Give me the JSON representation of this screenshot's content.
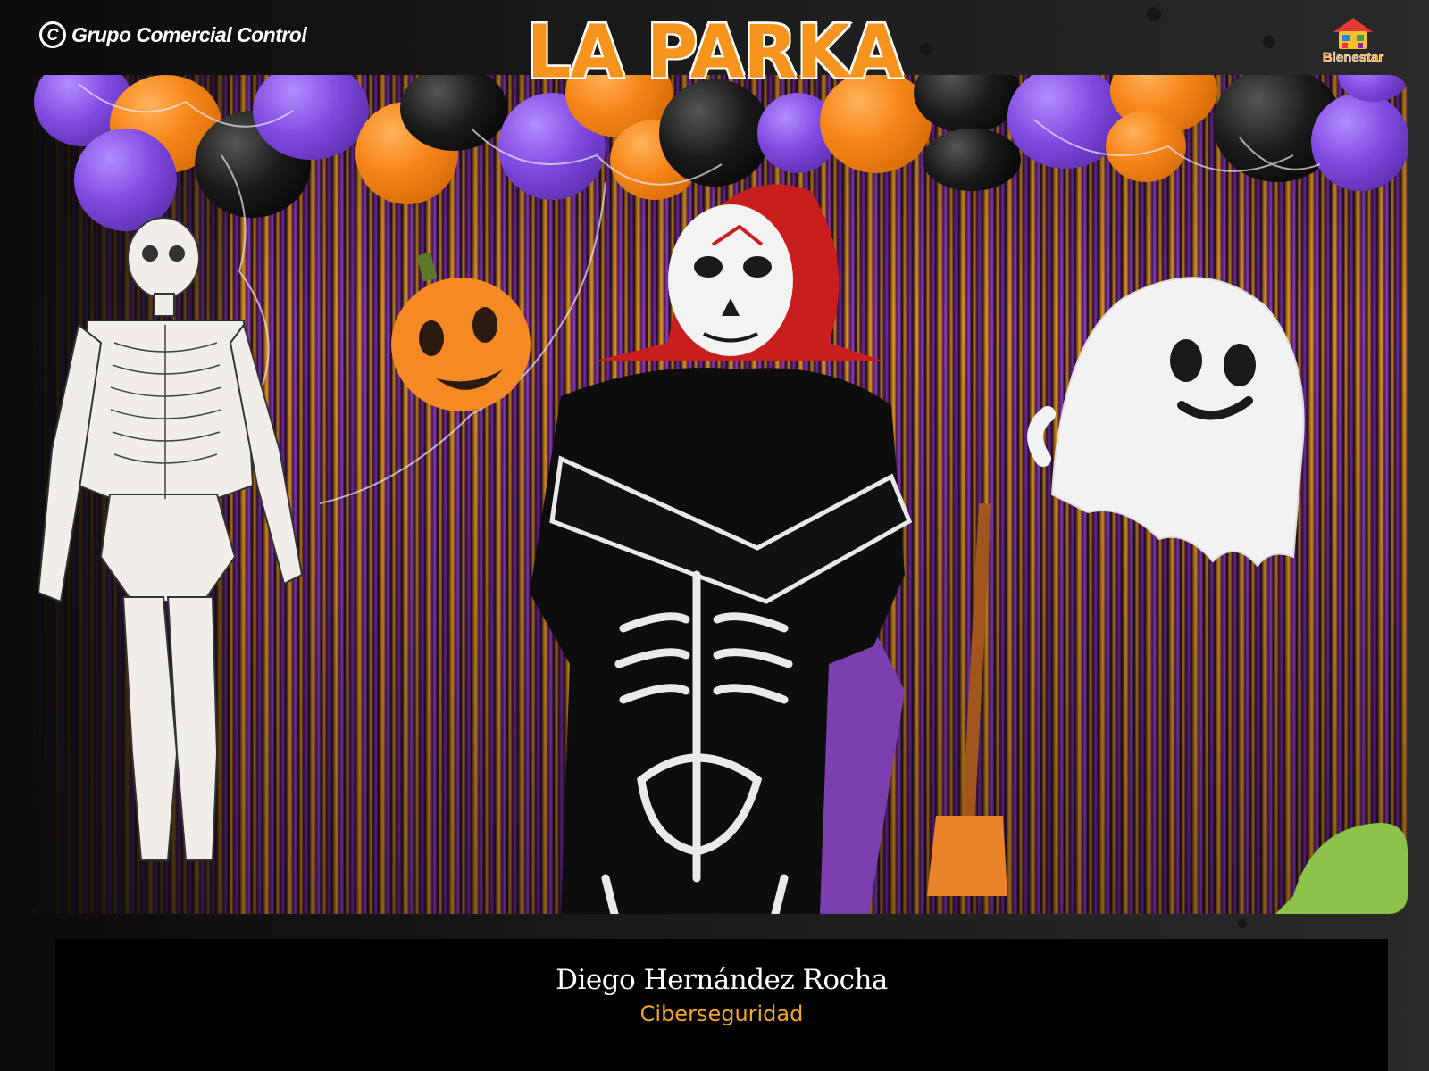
{
  "header": {
    "brand_left": "Grupo Comercial Control",
    "title": "LA PARKA",
    "brand_right": "Bienestar"
  },
  "photo": {
    "icons": [
      "skeleton-decoration",
      "pumpkin-decoration",
      "ghost-decoration",
      "broom-decoration",
      "balloon-garland"
    ]
  },
  "caption": {
    "name": "Diego Hernández Rocha",
    "department": "Ciberseguridad"
  },
  "colors": {
    "title_orange": "#f7941d",
    "department_gold": "#f5a623",
    "caption_bg": "#000000"
  }
}
